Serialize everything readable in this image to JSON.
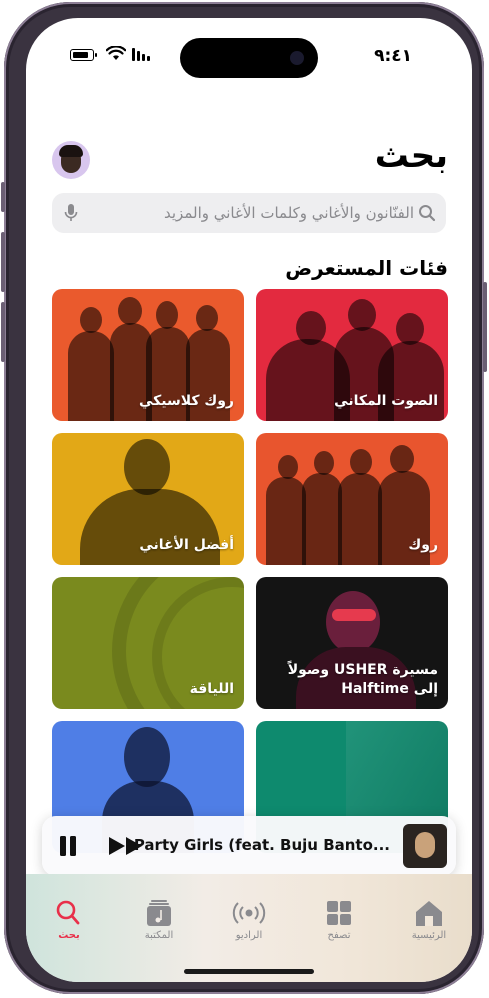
{
  "status_bar": {
    "time": "٩:٤١"
  },
  "header": {
    "title": "بحث"
  },
  "search": {
    "placeholder": "الفنّانون والأغاني وكلمات الأغاني والمزيد"
  },
  "browse": {
    "title": "فئات المستعرض",
    "tiles": [
      {
        "label": "الصوت المكاني",
        "color": "#e32a3f"
      },
      {
        "label": "روك كلاسيكي",
        "color": "#ea5a2d"
      },
      {
        "label": "روك",
        "color": "#e8552e"
      },
      {
        "label": "أفضل الأغاني",
        "color": "#e2a817"
      },
      {
        "label": "مسيرة USHER وصولاً إلى Halftime",
        "color": "#141414"
      },
      {
        "label": "اللياقة",
        "color": "#7a8a1e"
      },
      {
        "label": "",
        "color": "#0e8a6e"
      },
      {
        "label": "",
        "color": "#4f7ee6"
      }
    ]
  },
  "mini_player": {
    "track": "Party Girls (feat. Buju Banto..."
  },
  "tabs": [
    {
      "label": "الرئيسية",
      "icon": "home-icon"
    },
    {
      "label": "تصفح",
      "icon": "grid-icon"
    },
    {
      "label": "الراديو",
      "icon": "radio-icon"
    },
    {
      "label": "المكتبة",
      "icon": "library-icon"
    },
    {
      "label": "بحث",
      "icon": "search-icon",
      "active": true
    }
  ],
  "colors": {
    "accent": "#e8304a"
  }
}
